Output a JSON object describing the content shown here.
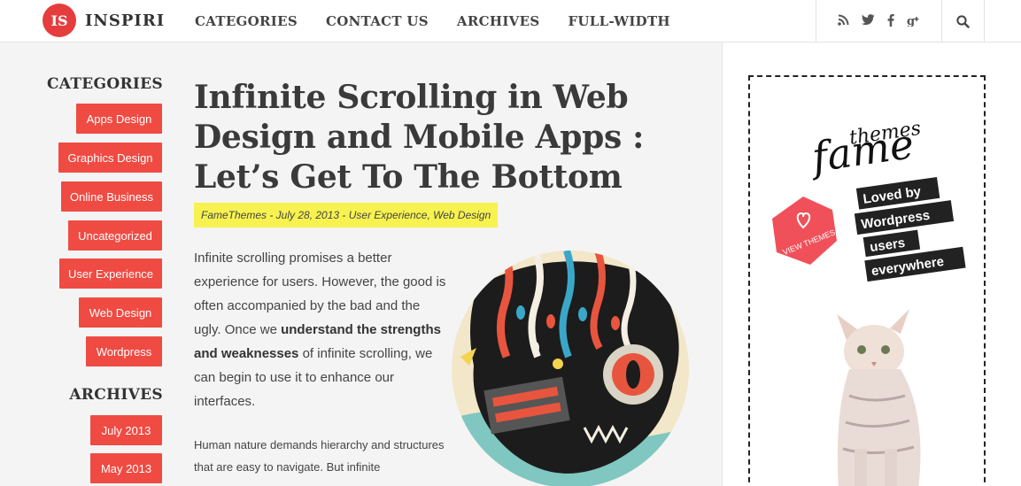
{
  "header": {
    "logo_badge": "IS",
    "logo_text": "INSPIRI",
    "nav": [
      "CATEGORIES",
      "CONTACT US",
      "ARCHIVES",
      "FULL-WIDTH"
    ]
  },
  "icons": {
    "social": [
      "rss-icon",
      "twitter-icon",
      "facebook-icon",
      "google-plus-icon"
    ],
    "search": "search-icon"
  },
  "sidebar": {
    "categories_heading": "CATEGORIES",
    "categories": [
      "Apps Design",
      "Graphics Design",
      "Online Business",
      "Uncategorized",
      "User Experience",
      "Web Design",
      "Wordpress"
    ],
    "archives_heading": "ARCHIVES",
    "archives": [
      "July 2013",
      "May 2013"
    ]
  },
  "article": {
    "title": "Infinite Scrolling in Web Design and Mobile Apps : Let’s Get To The Bottom",
    "meta": "FameThemes - July 28, 2013 - User Experience, Web Design",
    "intro_a": "Infinite scrolling promises a better experience for users. However, the good is often accompanied by the bad and the ugly. Once we ",
    "intro_bold": "understand the strengths and weaknesses",
    "intro_b": " of infinite scrolling, we can begin to use it to enhance our interfaces.",
    "body2": "Human nature demands hierarchy and structures that are easy to navigate. But infinite"
  },
  "ad": {
    "brand_small": "themes",
    "brand_large": "fame",
    "view_themes": "VIEW THEMES",
    "tagline": [
      "Loved by",
      "Wordpress",
      "users",
      "everywhere"
    ]
  },
  "colors": {
    "accent_red": "#ef4b43",
    "highlight_yellow": "#f7f24f",
    "ad_pink": "#f0505a"
  }
}
